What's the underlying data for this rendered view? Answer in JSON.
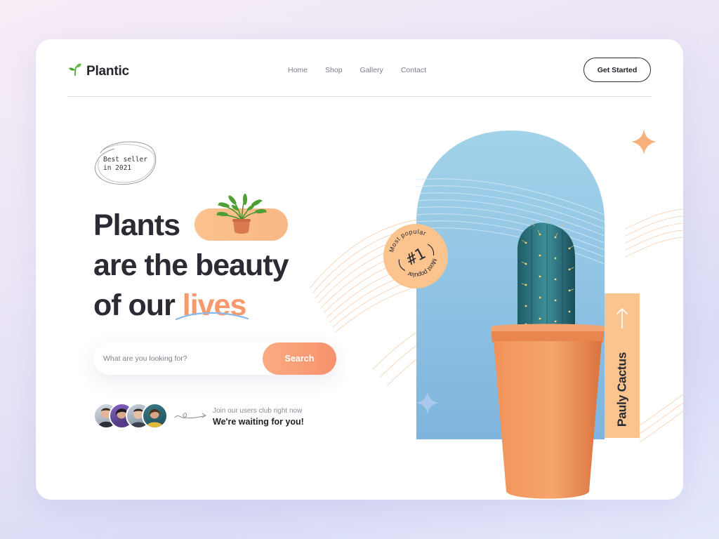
{
  "brand": {
    "name": "Plantic"
  },
  "nav": {
    "items": [
      "Home",
      "Shop",
      "Gallery",
      "Contact"
    ]
  },
  "header": {
    "cta_label": "Get Started"
  },
  "badge": {
    "line1": "Best seller",
    "line2": "in 2021"
  },
  "headline": {
    "line1": "Plants",
    "line2": "are the beauty",
    "line3_prefix": "of our ",
    "line3_accent": "lives"
  },
  "search": {
    "placeholder": "What are you looking for?",
    "button_label": "Search"
  },
  "club": {
    "subtitle": "Join our users club right now",
    "title": "We're waiting for you!"
  },
  "popular_badge": {
    "ring_text_top": "Most popular",
    "ring_text_bottom": "Most popular",
    "rank": "#1"
  },
  "product": {
    "name": "Pauly Cactus"
  },
  "colors": {
    "accent": "#f69a6c",
    "peach": "#fbc38e",
    "arch_blue": "#9fcfe6",
    "text_dark": "#2a2b33"
  }
}
